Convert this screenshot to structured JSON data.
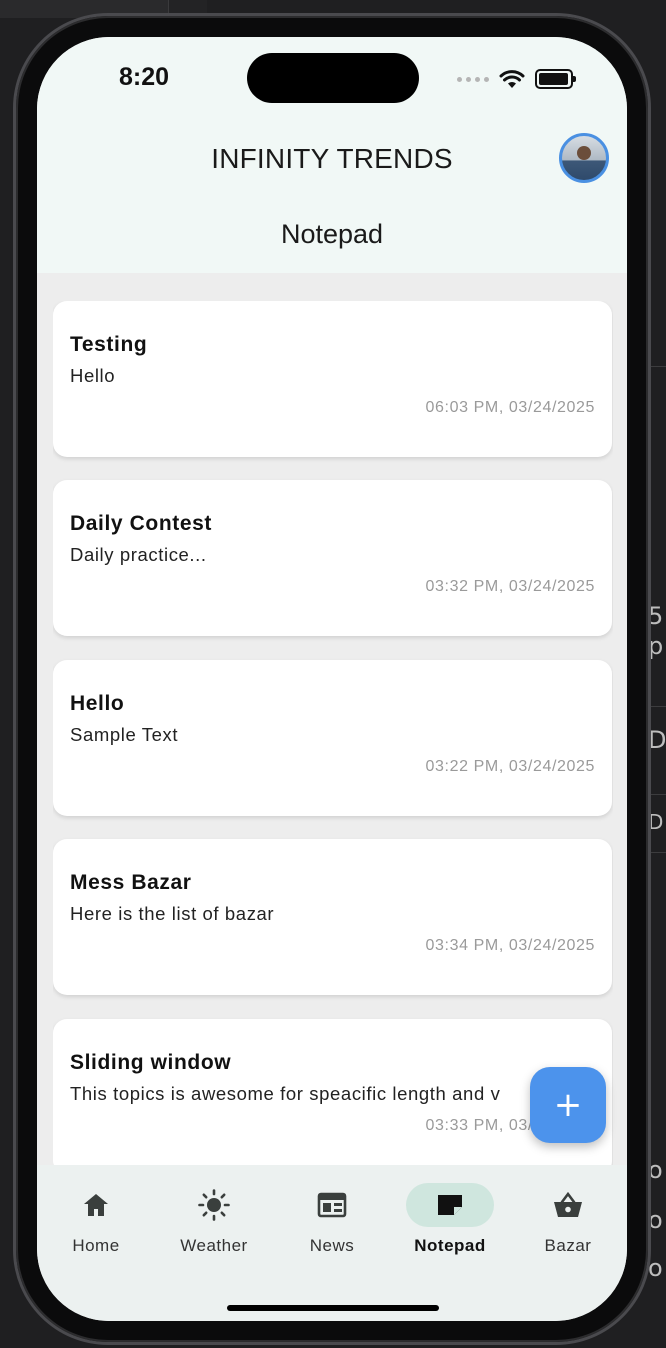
{
  "status_bar": {
    "time": "8:20"
  },
  "app": {
    "title": "INFINITY TRENDS",
    "page_title": "Notepad"
  },
  "notes": [
    {
      "title": "Testing",
      "body": "Hello",
      "time": "06:03 PM, 03/24/2025"
    },
    {
      "title": "Daily Contest",
      "body": "Daily practice...",
      "time": "03:32 PM, 03/24/2025"
    },
    {
      "title": "Hello",
      "body": "Sample Text",
      "time": "03:22 PM, 03/24/2025"
    },
    {
      "title": "Mess Bazar",
      "body": "Here is the list of bazar",
      "time": "03:34 PM, 03/24/2025"
    },
    {
      "title": "Sliding window",
      "body": "This topics is awesome for speacific length and v",
      "time": "03:33 PM, 03/24/2025"
    }
  ],
  "fab": {
    "label": "+"
  },
  "nav": [
    {
      "label": "Home",
      "icon": "home-icon"
    },
    {
      "label": "Weather",
      "icon": "sun-icon"
    },
    {
      "label": "News",
      "icon": "newspaper-icon"
    },
    {
      "label": "Notepad",
      "icon": "note-icon",
      "active": true
    },
    {
      "label": "Bazar",
      "icon": "basket-icon"
    }
  ],
  "colors": {
    "accent": "#4c93ec",
    "nav_active": "#cfe6de",
    "appbar": "#f1f8f6",
    "background": "#ededed"
  },
  "background_text": [
    "5",
    "p",
    "D",
    "D",
    "o",
    "o",
    "o"
  ]
}
